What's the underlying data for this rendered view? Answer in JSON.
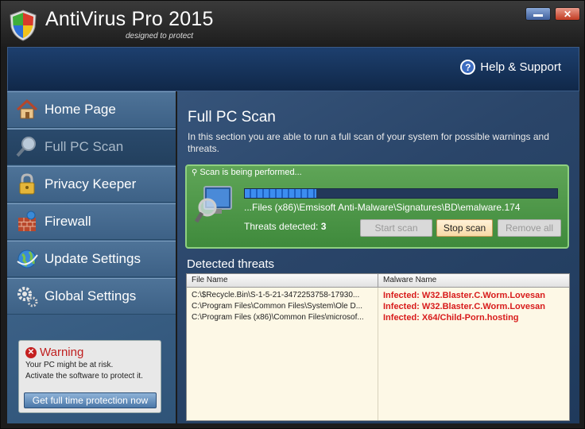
{
  "window": {
    "title": "AntiVirus Pro 2015",
    "tagline": "designed to protect",
    "min_label": "",
    "close_label": "✕"
  },
  "header": {
    "help_label": "Help & Support",
    "help_icon": "?"
  },
  "sidebar": {
    "items": [
      {
        "label": "Home Page",
        "icon": "house-icon"
      },
      {
        "label": "Full PC Scan",
        "icon": "magnifier-icon"
      },
      {
        "label": "Privacy Keeper",
        "icon": "padlock-icon"
      },
      {
        "label": "Firewall",
        "icon": "firewall-icon"
      },
      {
        "label": "Update Settings",
        "icon": "globe-icon"
      },
      {
        "label": "Global Settings",
        "icon": "gears-icon"
      }
    ],
    "active_index": 1,
    "warning": {
      "title": "Warning",
      "line1": "Your PC might be at risk.",
      "line2": "Activate the software to protect it.",
      "button": "Get full time protection now"
    }
  },
  "main": {
    "title": "Full PC Scan",
    "description": "In this section you are able to run a full scan of your system for possible warnings and threats.",
    "scan": {
      "status": "Scan is being performed...",
      "progress": 0.23,
      "current_file": "...Files (x86)\\Emsisoft Anti-Malware\\Signatures\\BD\\emalware.174",
      "threats_label": "Threats detected:",
      "threats_count": "3",
      "start_button": "Start scan",
      "stop_button": "Stop scan",
      "remove_button": "Remove all"
    },
    "detected_title": "Detected threats",
    "table": {
      "headers": [
        "File Name",
        "Malware Name"
      ],
      "rows": [
        {
          "file": "C:\\$Recycle.Bin\\S-1-5-21-3472253758-17930...",
          "malware": "Infected: W32.Blaster.C.Worm.Lovesan"
        },
        {
          "file": "C:\\Program Files\\Common Files\\System\\Ole D...",
          "malware": "Infected: W32.Blaster.C.Worm.Lovesan"
        },
        {
          "file": "C:\\Program Files (x86)\\Common Files\\microsof...",
          "malware": "Infected: X64/Child-Porn.hosting"
        }
      ]
    }
  },
  "colors": {
    "accent": "#3c8df0",
    "danger": "#d81b1b",
    "scan_panel": "#4f9a4a"
  }
}
